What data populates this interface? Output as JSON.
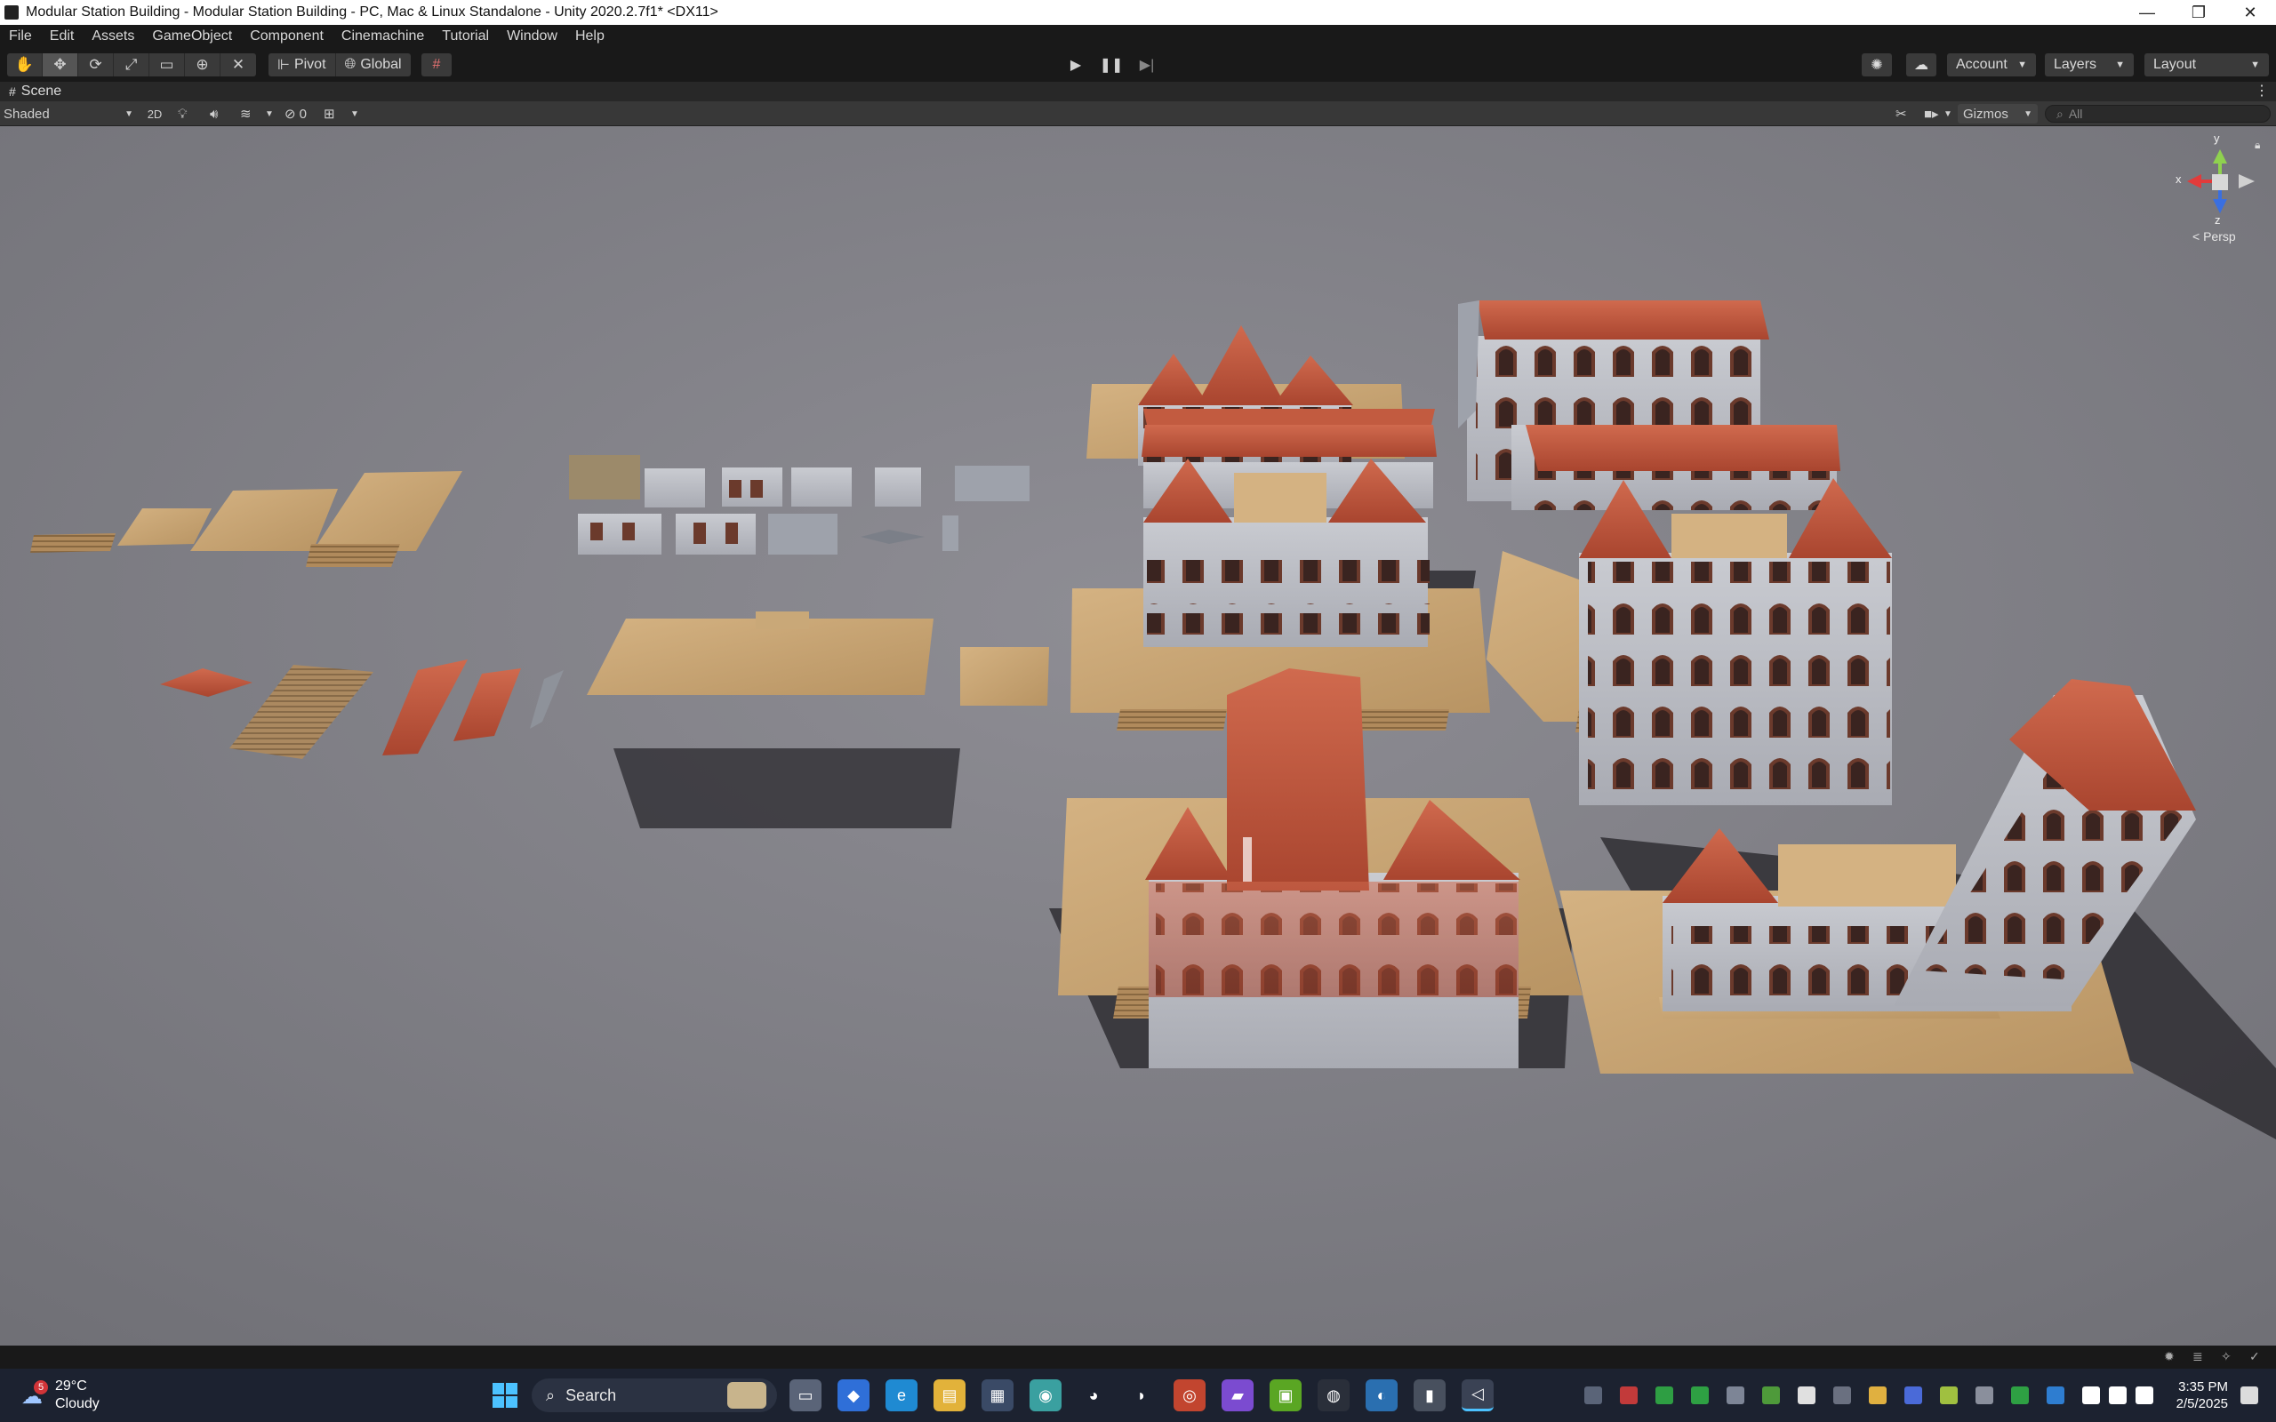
{
  "window": {
    "title": "Modular Station Building - Modular Station Building - PC, Mac & Linux Standalone - Unity 2020.2.7f1* <DX11>",
    "minimize": "—",
    "maximize": "❐",
    "close": "✕"
  },
  "menu": [
    "File",
    "Edit",
    "Assets",
    "GameObject",
    "Component",
    "Cinemachine",
    "Tutorial",
    "Window",
    "Help"
  ],
  "toolbar": {
    "pivot_label": "Pivot",
    "global_label": "Global",
    "account_label": "Account",
    "layers_label": "Layers",
    "layout_label": "Layout"
  },
  "scene": {
    "tab_label": "Scene",
    "shading_mode": "Shaded",
    "mode_2d": "2D",
    "hidden_count": "0",
    "gizmos_label": "Gizmos",
    "search_placeholder": "All",
    "axis_y": "y",
    "axis_x": "x",
    "axis_z": "z",
    "projection_label": "< Persp"
  },
  "taskbar": {
    "weather_temp": "29°C",
    "weather_desc": "Cloudy",
    "weather_badge": "5",
    "search_label": "Search",
    "time": "3:35 PM",
    "date": "2/5/2025"
  }
}
